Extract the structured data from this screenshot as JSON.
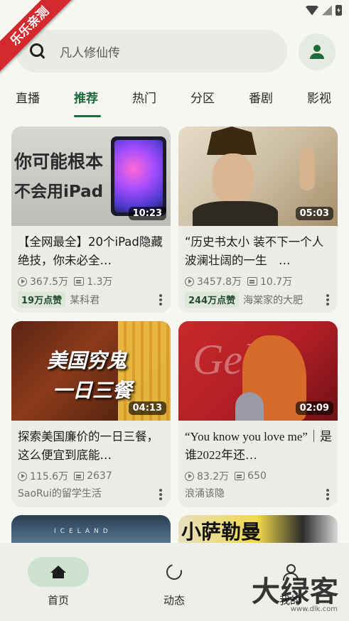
{
  "ribbon": "乐乐亲测",
  "search": {
    "placeholder": "凡人修仙传"
  },
  "tabs": [
    {
      "label": "直播"
    },
    {
      "label": "推荐",
      "active": true
    },
    {
      "label": "热门"
    },
    {
      "label": "分区"
    },
    {
      "label": "番剧"
    },
    {
      "label": "影视"
    }
  ],
  "cards": [
    {
      "duration": "10:23",
      "title": "【全网最全】20个iPad隐藏绝技，你未必全…",
      "views": "367.5万",
      "danmaku": "1.3万",
      "likes": "19万点赞",
      "author": "某科君",
      "thumb_text_1": "你可能根本",
      "thumb_text_2": "不会用iPad"
    },
    {
      "duration": "05:03",
      "title": "“历史书太小 装不下一个人波澜壮阔的一生　…",
      "views": "3457.8万",
      "danmaku": "10.7万",
      "likes": "244万点赞",
      "author": "海棠家的大肥"
    },
    {
      "duration": "04:13",
      "title": "探索美国廉价的一日三餐，这么便宜到底能…",
      "views": "115.6万",
      "danmaku": "2637",
      "likes": "",
      "author": "SaoRui的留学生活",
      "thumb_text_1": "美国穷鬼",
      "thumb_text_2": "一日三餐"
    },
    {
      "duration": "02:09",
      "title": "“You know you love me”｜是谁2022年还…",
      "views": "83.2万",
      "danmaku": "650",
      "likes": "",
      "author": "浪涌该隐"
    },
    {
      "duration": "",
      "title": "",
      "thumb_text_1": "ICELAND"
    },
    {
      "duration": "",
      "title": "",
      "thumb_text_1": "小萨勒曼"
    }
  ],
  "bottom_nav": [
    {
      "label": "首页",
      "icon": "home-icon",
      "active": true
    },
    {
      "label": "动态",
      "icon": "activity-icon"
    },
    {
      "label": "我的",
      "icon": "profile-icon"
    }
  ],
  "watermark": {
    "main": "大绿客",
    "sub": "www.dlk.com"
  },
  "colors": {
    "accent": "#1d6a3a",
    "ribbon": "#d3282c",
    "background": "#f6f7f2"
  }
}
